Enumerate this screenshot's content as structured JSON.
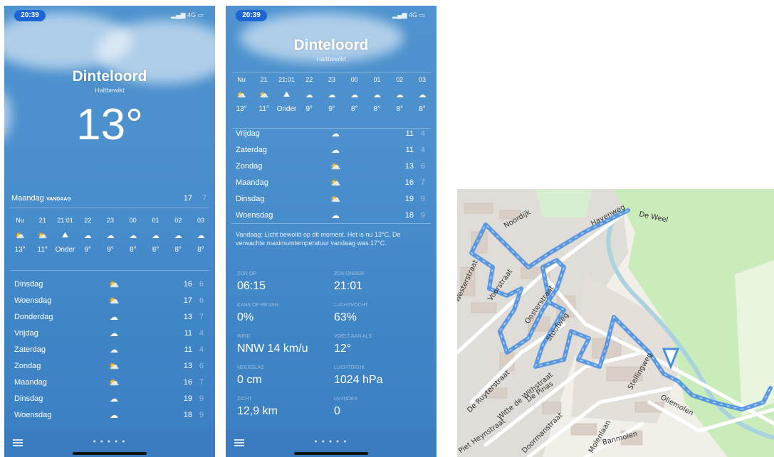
{
  "phone1": {
    "time": "20:39",
    "location": "Dinteloord",
    "sublocation": "Haltbewikt",
    "temperature": "13°",
    "today": {
      "label": "Maandag",
      "tag": "VANDAAG",
      "hi": "17",
      "lo": "7"
    },
    "hourly": [
      {
        "time": "Nu",
        "icon": "partly-cloudy-icon",
        "temp": "13°"
      },
      {
        "time": "21",
        "icon": "partly-cloudy-icon",
        "temp": "11°"
      },
      {
        "time": "21:01",
        "icon": "sunset-icon",
        "temp": "Onder"
      },
      {
        "time": "22",
        "icon": "cloud-icon",
        "temp": "9°"
      },
      {
        "time": "23",
        "icon": "cloud-icon",
        "temp": "9°"
      },
      {
        "time": "00",
        "icon": "cloud-icon",
        "temp": "8°"
      },
      {
        "time": "01",
        "icon": "cloud-icon",
        "temp": "8°"
      },
      {
        "time": "02",
        "icon": "cloud-icon",
        "temp": "8°"
      },
      {
        "time": "03",
        "icon": "cloud-icon",
        "temp": "8°"
      }
    ],
    "days": [
      {
        "name": "Dinsdag",
        "icon": "partly-cloudy-icon",
        "hi": "16",
        "lo": "6"
      },
      {
        "name": "Woensdag",
        "icon": "partly-cloudy-icon",
        "hi": "17",
        "lo": "6"
      },
      {
        "name": "Donderdag",
        "icon": "cloud-icon",
        "hi": "13",
        "lo": "7"
      },
      {
        "name": "Vrijdag",
        "icon": "cloud-icon",
        "hi": "11",
        "lo": "4"
      },
      {
        "name": "Zaterdag",
        "icon": "cloud-icon",
        "hi": "11",
        "lo": "4"
      },
      {
        "name": "Zondag",
        "icon": "partly-cloudy-icon",
        "hi": "13",
        "lo": "6"
      },
      {
        "name": "Maandag",
        "icon": "partly-cloudy-icon",
        "hi": "16",
        "lo": "7"
      },
      {
        "name": "Dinsdag",
        "icon": "cloud-icon",
        "hi": "19",
        "lo": "9"
      },
      {
        "name": "Woensdag",
        "icon": "cloud-icon",
        "hi": "18",
        "lo": "9"
      }
    ],
    "page_dots": "● ● ● ● ●"
  },
  "phone2": {
    "time": "20:39",
    "location": "Dinteloord",
    "sublocation": "Haltbewikt",
    "hourly": [
      {
        "time": "Nu",
        "icon": "partly-cloudy-icon",
        "temp": "13°"
      },
      {
        "time": "21",
        "icon": "partly-cloudy-icon",
        "temp": "11°"
      },
      {
        "time": "21:01",
        "icon": "sunset-icon",
        "temp": "Onder"
      },
      {
        "time": "22",
        "icon": "cloud-icon",
        "temp": "9°"
      },
      {
        "time": "23",
        "icon": "cloud-icon",
        "temp": "9°"
      },
      {
        "time": "00",
        "icon": "cloud-icon",
        "temp": "8°"
      },
      {
        "time": "01",
        "icon": "cloud-icon",
        "temp": "8°"
      },
      {
        "time": "02",
        "icon": "cloud-icon",
        "temp": "8°"
      },
      {
        "time": "03",
        "icon": "cloud-icon",
        "temp": "8°"
      }
    ],
    "days": [
      {
        "name": "Vrijdag",
        "icon": "cloud-icon",
        "hi": "11",
        "lo": "4"
      },
      {
        "name": "Zaterdag",
        "icon": "cloud-icon",
        "hi": "11",
        "lo": "4"
      },
      {
        "name": "Zondag",
        "icon": "partly-cloudy-icon",
        "hi": "13",
        "lo": "6"
      },
      {
        "name": "Maandag",
        "icon": "partly-cloudy-icon",
        "hi": "16",
        "lo": "7"
      },
      {
        "name": "Dinsdag",
        "icon": "partly-cloudy-icon",
        "hi": "19",
        "lo": "9"
      },
      {
        "name": "Woensdag",
        "icon": "cloud-icon",
        "hi": "18",
        "lo": "9"
      }
    ],
    "summary": "Vandaag: Licht bewolkt op dit moment. Het is nu 13°C. De verwachte maximumtemperatuur vandaag was 17°C.",
    "details": [
      {
        "label": "ZON OP",
        "value": "06:15"
      },
      {
        "label": "ZON ONDER",
        "value": "21:01"
      },
      {
        "label": "KANS OP REGEN",
        "value": "0%"
      },
      {
        "label": "LUCHTVOCHT.",
        "value": "63%"
      },
      {
        "label": "WIND",
        "value": "NNW 14 km/u"
      },
      {
        "label": "VOELT AAN ALS",
        "value": "12°"
      },
      {
        "label": "NEERSLAG",
        "value": "0 cm"
      },
      {
        "label": "LUCHTDRUK",
        "value": "1024 hPa"
      },
      {
        "label": "ZICHT",
        "value": "12,9 km"
      },
      {
        "label": "UV-INDEX",
        "value": "0"
      }
    ],
    "page_dots": "● ● ● ● ●"
  },
  "map": {
    "streets": [
      "Havenweg",
      "De Weel",
      "Noordijk",
      "Voorstraat",
      "Oosterstraat",
      "Westerstraat",
      "Stoofweg",
      "De Ruyterstraat",
      "Witte de Withstraat",
      "De Pinas",
      "Stellingweg",
      "Oliemolen",
      "Piet Heynstraat",
      "Doormanstraat",
      "Molenlaan",
      "Banmolen"
    ],
    "colors": {
      "route": "#4a90e2",
      "park": "#c9ecba",
      "residential": "#e0dcd8",
      "water": "#aad3df",
      "building": "#d9cfc6"
    }
  }
}
